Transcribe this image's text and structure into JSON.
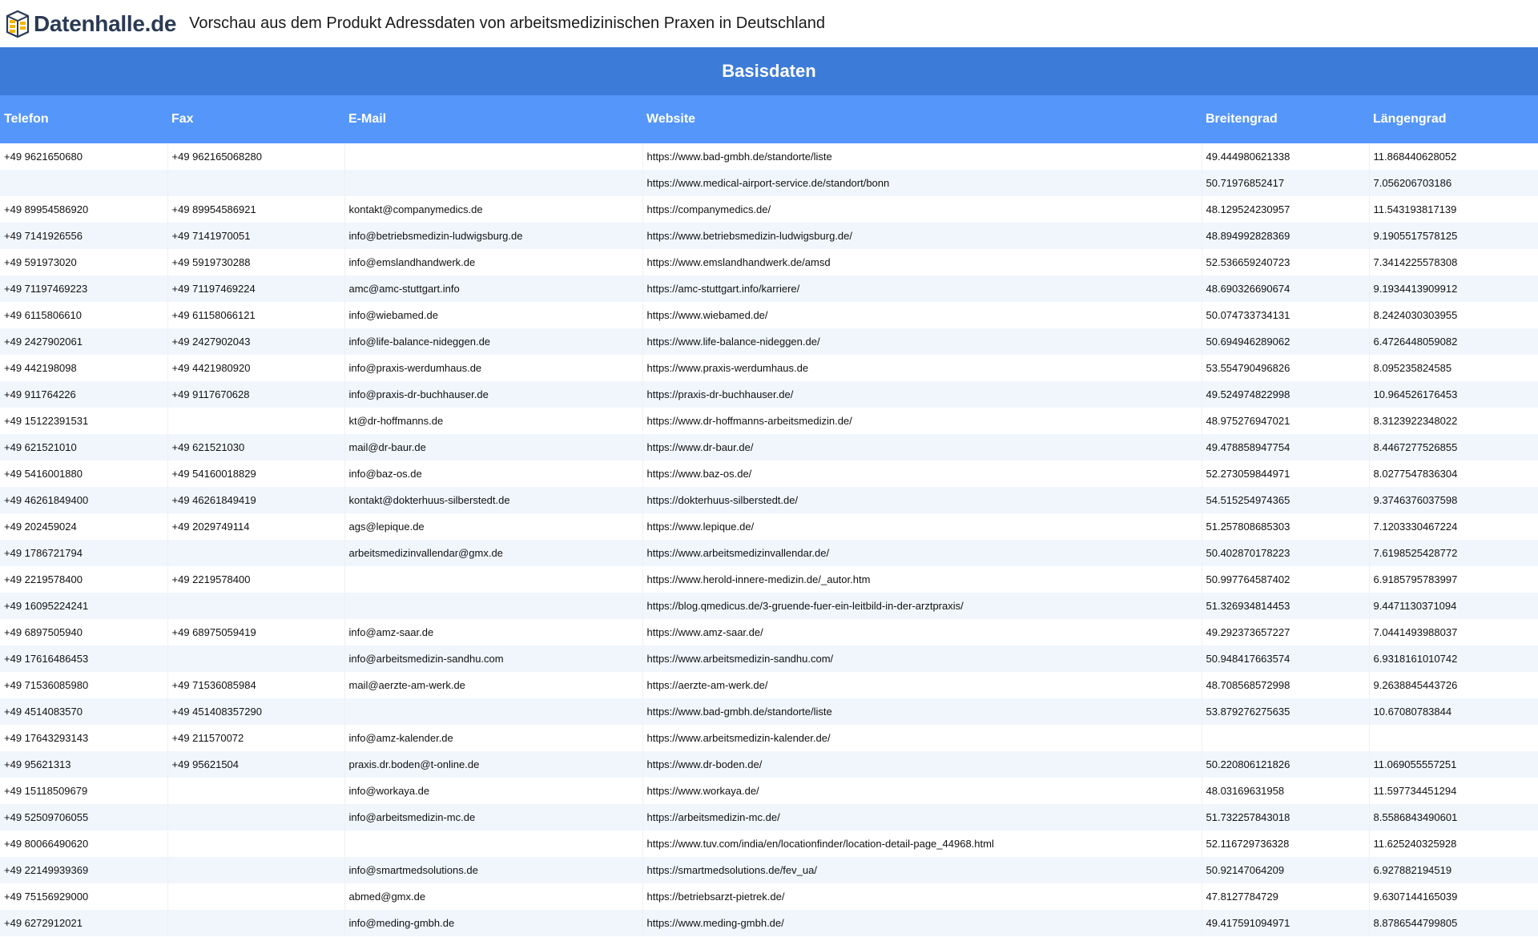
{
  "header": {
    "logo_text": "Datenhalle.de",
    "title": "Vorschau aus dem Produkt Adressdaten von arbeitsmedizinischen Praxen in Deutschland"
  },
  "section": {
    "title": "Basisdaten"
  },
  "table": {
    "columns": [
      "Telefon",
      "Fax",
      "E-Mail",
      "Website",
      "Breitengrad",
      "Längengrad"
    ],
    "rows": [
      [
        "+49 9621650680",
        "+49 962165068280",
        "",
        "https://www.bad-gmbh.de/standorte/liste",
        "49.444980621338",
        "11.868440628052"
      ],
      [
        "",
        "",
        "",
        "https://www.medical-airport-service.de/standort/bonn",
        "50.71976852417",
        "7.056206703186"
      ],
      [
        "+49 89954586920",
        "+49 89954586921",
        "kontakt@companymedics.de",
        "https://companymedics.de/",
        "48.129524230957",
        "11.543193817139"
      ],
      [
        "+49 7141926556",
        "+49 7141970051",
        "info@betriebsmedizin-ludwigsburg.de",
        "https://www.betriebsmedizin-ludwigsburg.de/",
        "48.894992828369",
        "9.1905517578125"
      ],
      [
        "+49 591973020",
        "+49 5919730288",
        "info@emslandhandwerk.de",
        "https://www.emslandhandwerk.de/amsd",
        "52.536659240723",
        "7.3414225578308"
      ],
      [
        "+49 71197469223",
        "+49 71197469224",
        "amc@amc-stuttgart.info",
        "https://amc-stuttgart.info/karriere/",
        "48.690326690674",
        "9.1934413909912"
      ],
      [
        "+49 6115806610",
        "+49 61158066121",
        "info@wiebamed.de",
        "https://www.wiebamed.de/",
        "50.074733734131",
        "8.2424030303955"
      ],
      [
        "+49 2427902061",
        "+49 2427902043",
        "info@life-balance-nideggen.de",
        "https://www.life-balance-nideggen.de/",
        "50.694946289062",
        "6.4726448059082"
      ],
      [
        "+49 442198098",
        "+49 4421980920",
        "info@praxis-werdumhaus.de",
        "https://www.praxis-werdumhaus.de",
        "53.554790496826",
        "8.095235824585"
      ],
      [
        "+49 911764226",
        "+49 9117670628",
        "info@praxis-dr-buchhauser.de",
        "https://praxis-dr-buchhauser.de/",
        "49.524974822998",
        "10.964526176453"
      ],
      [
        "+49 15122391531",
        "",
        "kt@dr-hoffmanns.de",
        "https://www.dr-hoffmanns-arbeitsmedizin.de/",
        "48.975276947021",
        "8.3123922348022"
      ],
      [
        "+49 621521010",
        "+49 621521030",
        "mail@dr-baur.de",
        "https://www.dr-baur.de/",
        "49.478858947754",
        "8.4467277526855"
      ],
      [
        "+49 5416001880",
        "+49 54160018829",
        "info@baz-os.de",
        "https://www.baz-os.de/",
        "52.273059844971",
        "8.0277547836304"
      ],
      [
        "+49 46261849400",
        "+49 46261849419",
        "kontakt@dokterhuus-silberstedt.de",
        "https://dokterhuus-silberstedt.de/",
        "54.515254974365",
        "9.3746376037598"
      ],
      [
        "+49 202459024",
        "+49 2029749114",
        "ags@lepique.de",
        "https://www.lepique.de/",
        "51.257808685303",
        "7.1203330467224"
      ],
      [
        "+49 1786721794",
        "",
        "arbeitsmedizinvallendar@gmx.de",
        "https://www.arbeitsmedizinvallendar.de/",
        "50.402870178223",
        "7.6198525428772"
      ],
      [
        "+49 2219578400",
        "+49 2219578400",
        "",
        "https://www.herold-innere-medizin.de/_autor.htm",
        "50.997764587402",
        "6.9185795783997"
      ],
      [
        "+49 16095224241",
        "",
        "",
        "https://blog.qmedicus.de/3-gruende-fuer-ein-leitbild-in-der-arztpraxis/",
        "51.326934814453",
        "9.4471130371094"
      ],
      [
        "+49 6897505940",
        "+49 68975059419",
        "info@amz-saar.de",
        "https://www.amz-saar.de/",
        "49.292373657227",
        "7.0441493988037"
      ],
      [
        "+49 17616486453",
        "",
        "info@arbeitsmedizin-sandhu.com",
        "https://www.arbeitsmedizin-sandhu.com/",
        "50.948417663574",
        "6.9318161010742"
      ],
      [
        "+49 71536085980",
        "+49 71536085984",
        "mail@aerzte-am-werk.de",
        "https://aerzte-am-werk.de/",
        "48.708568572998",
        "9.2638845443726"
      ],
      [
        "+49 4514083570",
        "+49 451408357290",
        "",
        "https://www.bad-gmbh.de/standorte/liste",
        "53.879276275635",
        "10.67080783844"
      ],
      [
        "+49 17643293143",
        "+49 211570072",
        "info@amz-kalender.de",
        "https://www.arbeitsmedizin-kalender.de/",
        "",
        ""
      ],
      [
        "+49 95621313",
        "+49 95621504",
        "praxis.dr.boden@t-online.de",
        "https://www.dr-boden.de/",
        "50.220806121826",
        "11.069055557251"
      ],
      [
        "+49 15118509679",
        "",
        "info@workaya.de",
        "https://www.workaya.de/",
        "48.03169631958",
        "11.597734451294"
      ],
      [
        "+49 52509706055",
        "",
        "info@arbeitsmedizin-mc.de",
        "https://arbeitsmedizin-mc.de/",
        "51.732257843018",
        "8.5586843490601"
      ],
      [
        "+49 80066490620",
        "",
        "",
        "https://www.tuv.com/india/en/locationfinder/location-detail-page_44968.html",
        "52.116729736328",
        "11.625240325928"
      ],
      [
        "+49 22149939369",
        "",
        "info@smartmedsolutions.de",
        "https://smartmedsolutions.de/fev_ua/",
        "50.92147064209",
        "6.927882194519"
      ],
      [
        "+49 75156929000",
        "",
        "abmed@gmx.de",
        "https://betriebsarzt-pietrek.de/",
        "47.8127784729",
        "9.6307144165039"
      ],
      [
        "+49 6272912021",
        "",
        "info@meding-gmbh.de",
        "https://www.meding-gmbh.de/",
        "49.417591094971",
        "8.8786544799805"
      ]
    ]
  },
  "colors": {
    "section_header_bg": "#3d7bd9",
    "table_header_bg": "#5596fb",
    "row_alt_bg": "#f1f6fd"
  },
  "icons": {
    "logo": "database-stack-icon"
  }
}
